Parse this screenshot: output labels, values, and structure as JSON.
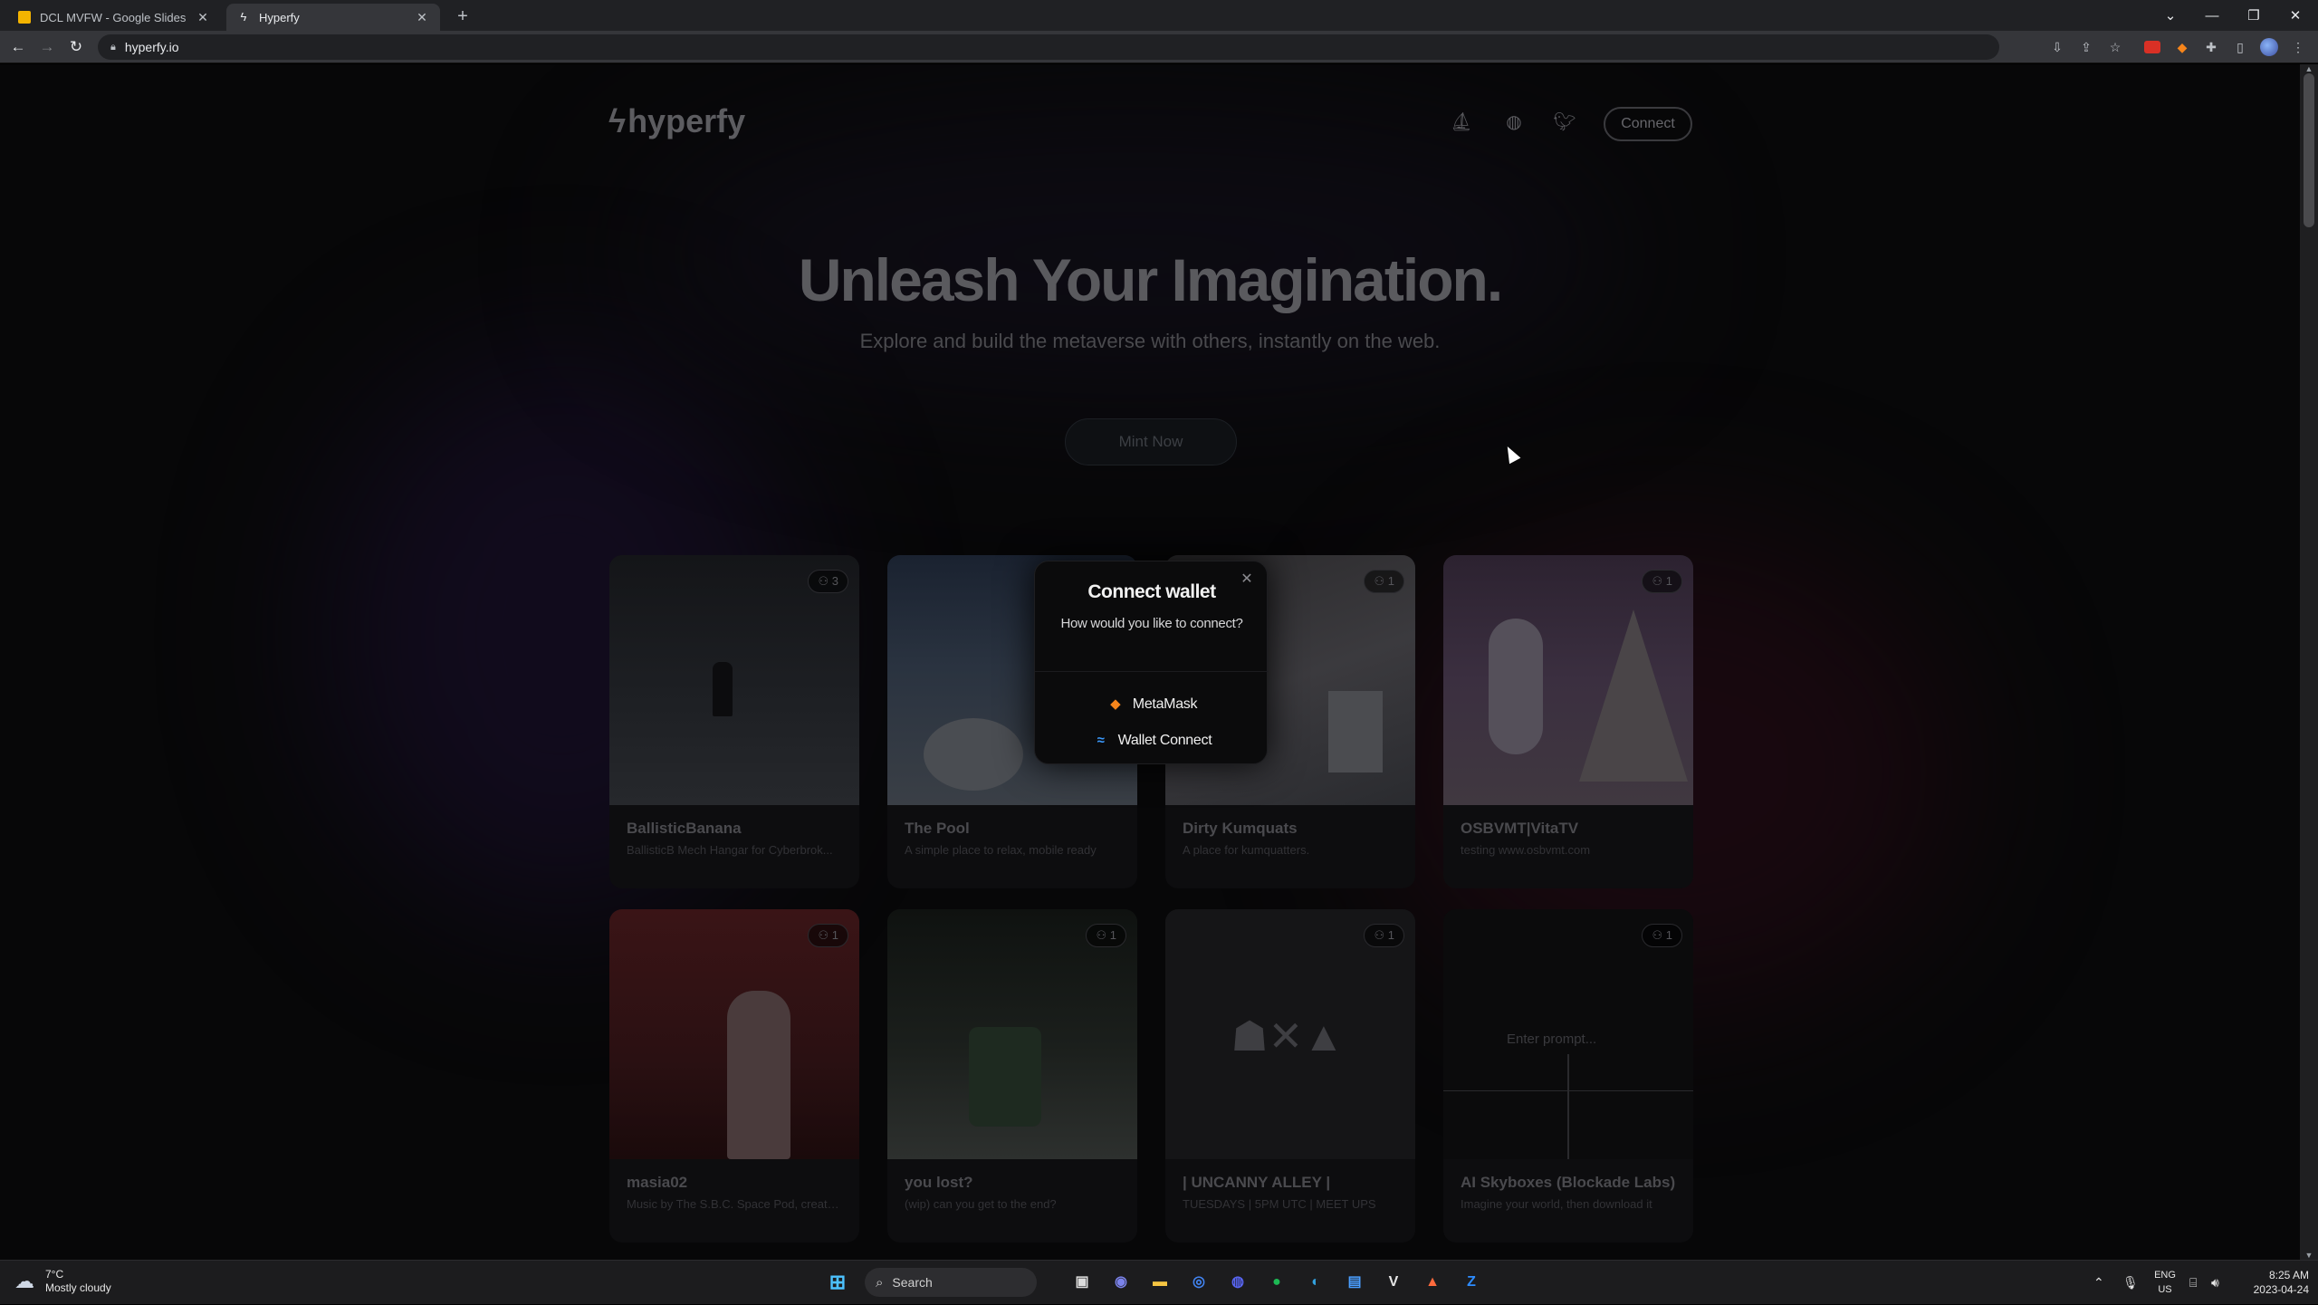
{
  "browser": {
    "tabs": [
      {
        "title": "DCL MVFW - Google Slides",
        "favicon": "slides-icon",
        "active": false
      },
      {
        "title": "Hyperfy",
        "favicon": "bolt-icon",
        "active": true
      }
    ],
    "url": "hyperfy.io",
    "window_controls": [
      "chevron-down-icon",
      "minimize-icon",
      "restore-icon",
      "close-icon"
    ]
  },
  "site": {
    "logo_text": "hyperfy",
    "nav_icons": [
      "opensea-icon",
      "discord-icon",
      "twitter-icon"
    ],
    "connect_label": "Connect",
    "hero_title": "Unleash Your Imagination.",
    "hero_subtitle": "Explore and build the metaverse with others, instantly on the web.",
    "mint_label": "Mint Now",
    "worlds": [
      {
        "title": "BallisticBanana",
        "desc": "BallisticB Mech Hangar for Cyberbrok...",
        "count": "3"
      },
      {
        "title": "The Pool",
        "desc": "A simple place to relax, mobile ready",
        "count": "1"
      },
      {
        "title": "Dirty Kumquats",
        "desc": "A place for kumquatters.",
        "count": "1"
      },
      {
        "title": "OSBVMT|VitaTV",
        "desc": "testing www.osbvmt.com",
        "count": "1"
      },
      {
        "title": "masia02",
        "desc": "Music by The S.B.C. Space Pod, created...",
        "count": "1"
      },
      {
        "title": "you lost?",
        "desc": "(wip) can you get to the end?",
        "count": "1"
      },
      {
        "title": "| UNCANNY ALLEY |",
        "desc": "TUESDAYS | 5PM UTC | MEET UPS",
        "count": "1"
      },
      {
        "title": "AI Skyboxes (Blockade Labs)",
        "desc": "Imagine your world, then download it",
        "count": "1"
      }
    ],
    "skybox_prompt_placeholder": "Enter prompt..."
  },
  "modal": {
    "title": "Connect wallet",
    "subtitle": "How would you like to connect?",
    "options": [
      {
        "label": "MetaMask",
        "icon": "metamask-fox-icon"
      },
      {
        "label": "Wallet Connect",
        "icon": "walletconnect-icon"
      }
    ]
  },
  "taskbar": {
    "weather_temp": "7°C",
    "weather_desc": "Mostly cloudy",
    "search_label": "Search",
    "lang_line1": "ENG",
    "lang_line2": "US",
    "time": "8:25 AM",
    "date": "2023-04-24"
  },
  "colors": {
    "accent_metamask": "#f6851b",
    "accent_walletconnect": "#3b99fc",
    "page_bg": "#070708"
  }
}
